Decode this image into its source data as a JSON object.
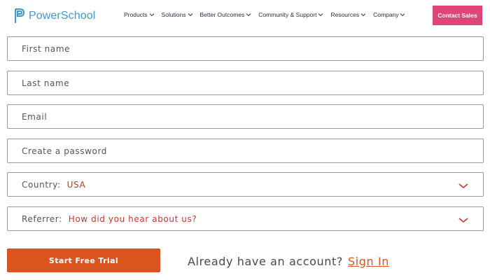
{
  "header": {
    "brand": "PowerSchool",
    "nav": [
      {
        "label": "Products"
      },
      {
        "label": "Solutions"
      },
      {
        "label": "Better Outcomes"
      },
      {
        "label": "Community & Support"
      },
      {
        "label": "Resources"
      },
      {
        "label": "Company"
      }
    ],
    "cta_label": "Contact Sales"
  },
  "form": {
    "first_name": {
      "placeholder": "First name"
    },
    "last_name": {
      "placeholder": "Last name"
    },
    "email": {
      "placeholder": "Email"
    },
    "password": {
      "placeholder": "Create a password"
    },
    "country": {
      "label": "Country:",
      "value": "USA"
    },
    "referrer": {
      "label": "Referrer:",
      "value": "How did you hear about us?"
    }
  },
  "actions": {
    "start_label": "Start Free Trial",
    "account_prompt": "Already have an account?",
    "signin_label": "Sign In"
  },
  "colors": {
    "brand_blue": "#3d9bd3",
    "cta_pink": "#e0457a",
    "accent_orange": "#d9541e",
    "value_red": "#c0392b"
  }
}
